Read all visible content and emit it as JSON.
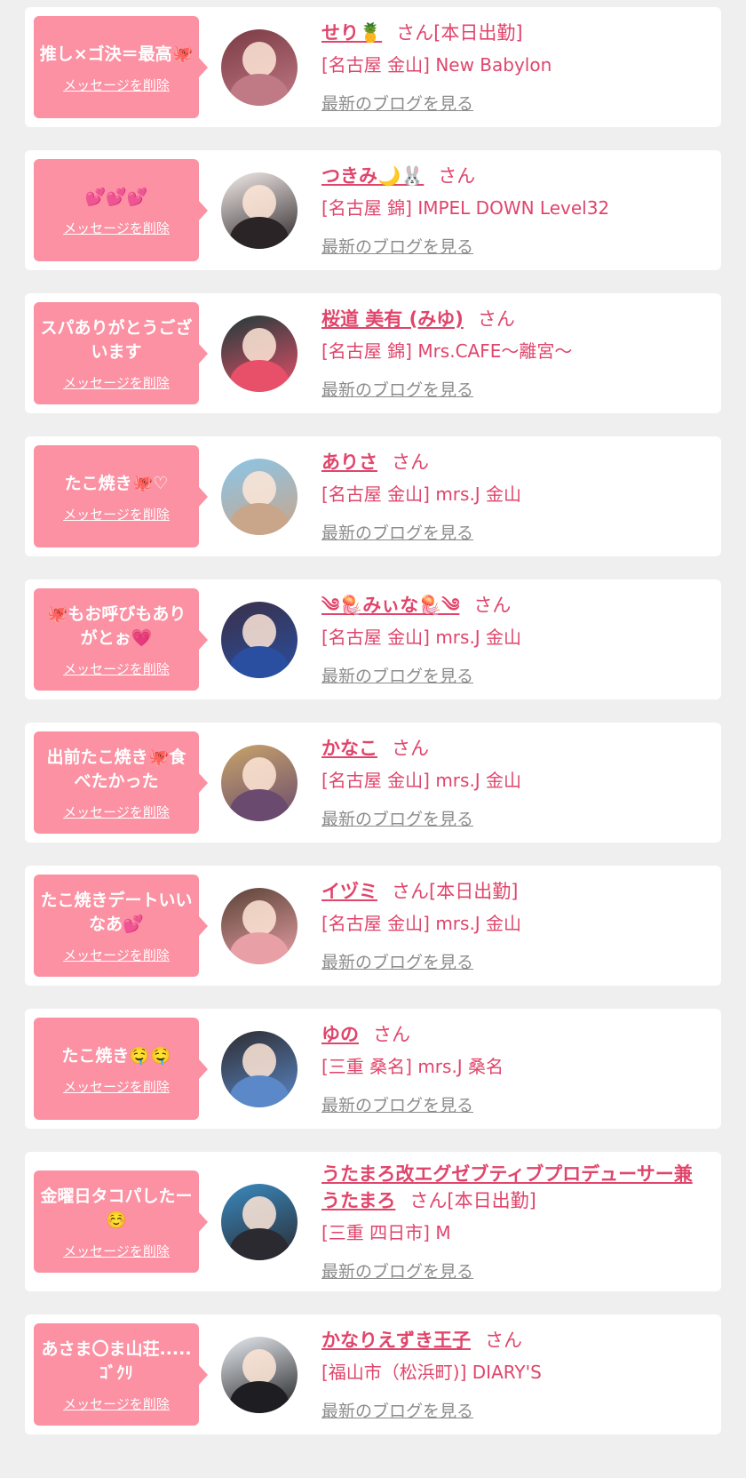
{
  "colors": {
    "accent": "#e0456b",
    "bubble": "#fb91a3",
    "link_gray": "#8c8c8c",
    "background": "#efefef"
  },
  "entries": [
    {
      "message": "推し×ゴ決＝最高🐙",
      "delete_label": "メッセージを削除",
      "name": "せり🍍",
      "san_label": "さん[本日出勤]",
      "shop": "[名古屋 金山] New Babylon",
      "blog_label": "最新のブログを見る",
      "avatar_colors": [
        "#7a3a44",
        "#c07a85"
      ]
    },
    {
      "message": "💕💕💕",
      "delete_label": "メッセージを削除",
      "name": "つきみ🌙🐰",
      "san_label": "さん",
      "shop": "[名古屋 錦] IMPEL DOWN Level32",
      "blog_label": "最新のブログを見る",
      "avatar_colors": [
        "#f3ecea",
        "#2b2426"
      ]
    },
    {
      "message": "スパありがとうございます",
      "delete_label": "メッセージを削除",
      "name": "桜道 美有 (みゆ)",
      "san_label": "さん",
      "shop": "[名古屋 錦] Mrs.CAFE〜離宮〜",
      "blog_label": "最新のブログを見る",
      "avatar_colors": [
        "#1f3b3a",
        "#e8506a"
      ]
    },
    {
      "message": "たこ焼き🐙♡",
      "delete_label": "メッセージを削除",
      "name": "ありさ",
      "san_label": "さん",
      "shop": "[名古屋 金山] mrs.J 金山",
      "blog_label": "最新のブログを見る",
      "avatar_colors": [
        "#8ac6e8",
        "#c9a58a"
      ]
    },
    {
      "message": "🐙もお呼びもありがとぉ💗",
      "delete_label": "メッセージを削除",
      "name": "༄🪼みぃな🪼༄",
      "san_label": "さん",
      "shop": "[名古屋 金山] mrs.J 金山",
      "blog_label": "最新のブログを見る",
      "avatar_colors": [
        "#3a3048",
        "#2a4ea0"
      ]
    },
    {
      "message": "出前たこ焼き🐙食べたかった",
      "delete_label": "メッセージを削除",
      "name": "かなこ",
      "san_label": "さん",
      "shop": "[名古屋 金山] mrs.J 金山",
      "blog_label": "最新のブログを見る",
      "avatar_colors": [
        "#c8a46a",
        "#6a4a6e"
      ]
    },
    {
      "message": "たこ焼きデートいいなあ💕",
      "delete_label": "メッセージを削除",
      "name": "イヅミ",
      "san_label": "さん[本日出勤]",
      "shop": "[名古屋 金山] mrs.J 金山",
      "blog_label": "最新のブログを見る",
      "avatar_colors": [
        "#5a4236",
        "#e8a0a6"
      ]
    },
    {
      "message": "たこ焼き🤤🤤",
      "delete_label": "メッセージを削除",
      "name": "ゆの",
      "san_label": "さん",
      "shop": "[三重 桑名] mrs.J 桑名",
      "blog_label": "最新のブログを見る",
      "avatar_colors": [
        "#2e2c30",
        "#5a88c8"
      ]
    },
    {
      "message": "金曜日タコパしたー☺️",
      "delete_label": "メッセージを削除",
      "name": "うたまろ改エグゼブティブプロデューサー兼うたまろ",
      "san_label": "さん[本日出勤]",
      "shop": "[三重 四日市] M",
      "blog_label": "最新のブログを見る",
      "avatar_colors": [
        "#3a8ac0",
        "#2a2a30"
      ]
    },
    {
      "message": "あさま〇ま山荘.....ｺﾞｸﾘ",
      "delete_label": "メッセージを削除",
      "name": "かなりえずき王子",
      "san_label": "さん",
      "shop": "[福山市（松浜町)] DIARY'S",
      "blog_label": "最新のブログを見る",
      "avatar_colors": [
        "#e8ecf0",
        "#1e1e22"
      ]
    }
  ]
}
